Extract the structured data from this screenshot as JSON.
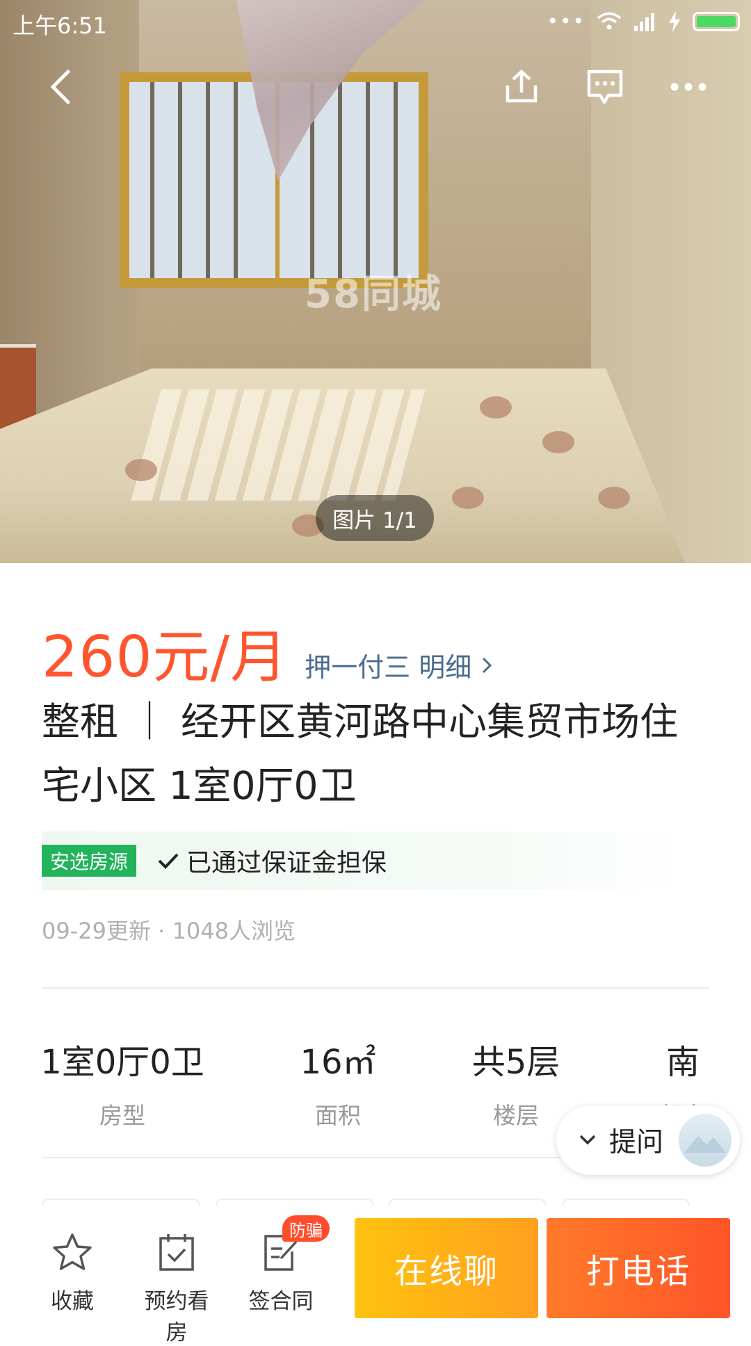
{
  "status_bar": {
    "time": "上午6:51"
  },
  "hero": {
    "watermark": "58同城",
    "photo_count": "图片 1/1"
  },
  "listing": {
    "price": "260元/月",
    "payment_terms": "押一付三 明细",
    "title": "整租 ｜ 经开区黄河路中心集贸市场住宅小区 1室0厅0卫",
    "verified_tag": "安选房源",
    "guarantee_text": "已通过保证金担保",
    "meta": "09-29更新 · 1048人浏览"
  },
  "specs": [
    {
      "value": "1室0厅0卫",
      "label": "房型"
    },
    {
      "value": "16㎡",
      "label": "面积"
    },
    {
      "value": "共5层",
      "label": "楼层"
    },
    {
      "value": "南",
      "label": "朝向"
    }
  ],
  "ask_button": {
    "label": "提问"
  },
  "bottom_bar": {
    "favorite": "收藏",
    "schedule_viewing": "预约看房",
    "sign_contract": "签合同",
    "anti_fraud_badge": "防骗",
    "chat_online": "在线聊",
    "call": "打电话"
  },
  "colors": {
    "price": "#ff552e",
    "verified": "#21b45a",
    "chat_cta": "#ffb317",
    "call_cta": "#ff6528"
  }
}
